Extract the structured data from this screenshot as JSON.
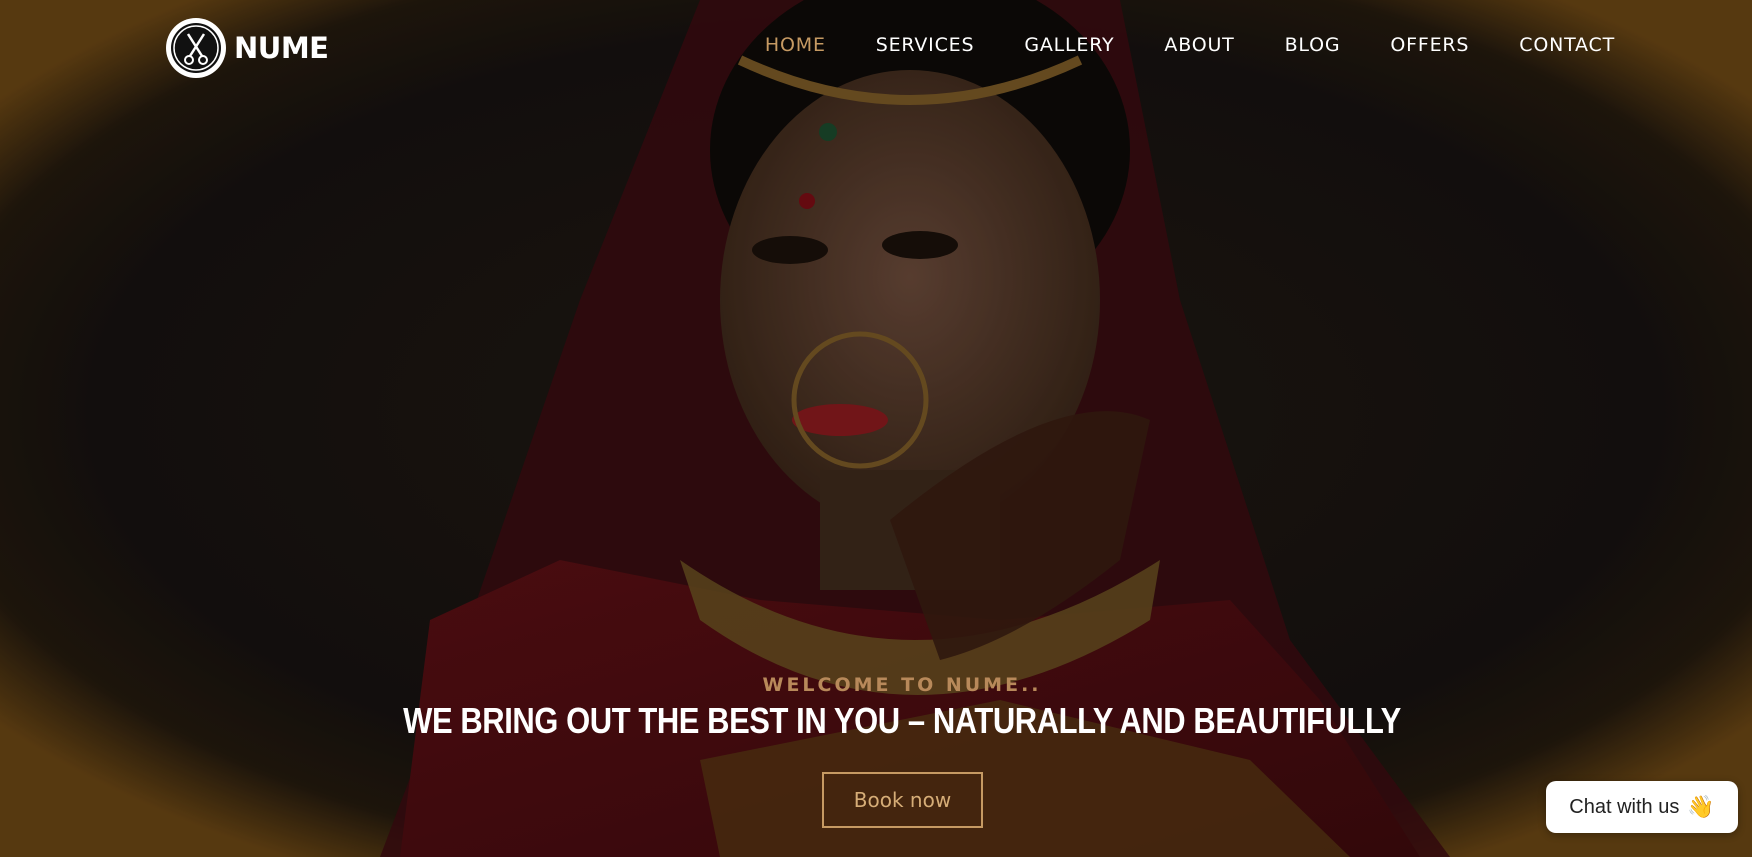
{
  "brand": {
    "name": "NUME",
    "logo_icon": "scissors-icon"
  },
  "nav": {
    "items": [
      {
        "label": "HOME",
        "active": true
      },
      {
        "label": "SERVICES",
        "active": false
      },
      {
        "label": "GALLERY",
        "active": false
      },
      {
        "label": "ABOUT",
        "active": false
      },
      {
        "label": "BLOG",
        "active": false
      },
      {
        "label": "OFFERS",
        "active": false
      },
      {
        "label": "CONTACT",
        "active": false
      }
    ]
  },
  "hero": {
    "eyebrow": "WELCOME TO NUME..",
    "headline": "WE BRING OUT THE BEST IN YOU – NATURALLY AND BEAUTIFULLY",
    "cta_label": "Book now",
    "background_image": "bride-portrait"
  },
  "chat": {
    "label": "Chat with us",
    "icon": "waving-hand-icon",
    "emoji": "👋"
  },
  "colors": {
    "accent": "#c69a63",
    "text": "#ffffff",
    "background": "#120d09",
    "chat_bg": "#ffffff"
  }
}
